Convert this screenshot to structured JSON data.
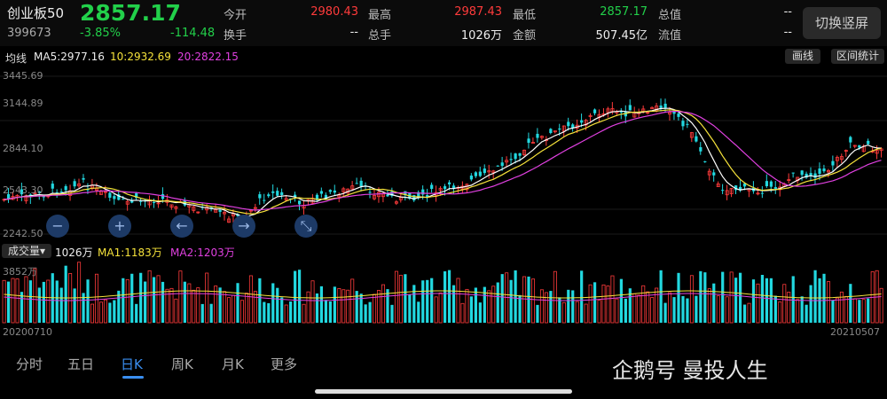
{
  "header": {
    "name": "创业板50",
    "price": "2857.17",
    "code": "399673",
    "change_pct": "-3.85%",
    "change_abs": "-114.48",
    "labels": {
      "open": "今开",
      "high": "最高",
      "low": "最低",
      "total_value": "总值",
      "turnover": "换手",
      "volume": "总手",
      "amount": "金额",
      "float_value": "流值"
    },
    "values": {
      "open": "2980.43",
      "high": "2987.43",
      "low": "2857.17",
      "total_value": "--",
      "turnover": "--",
      "volume": "1026万",
      "amount": "507.45亿",
      "float_value": "--"
    },
    "switch_button": "切换竖屏"
  },
  "ma_bar": {
    "label": "均线",
    "ma5": "MA5:2977.16",
    "ma10": "10:2932.69",
    "ma20": "20:2822.15",
    "draw_button": "画线",
    "stats_button": "区间统计"
  },
  "price_axis": {
    "p1": "3445.69",
    "p2": "3144.89",
    "p3": "2844.10",
    "p4": "2543.30",
    "p5": "2242.50"
  },
  "volume_bar": {
    "selector": "成交量",
    "vol": "1026万",
    "ma1": "MA1:1183万",
    "ma2": "MA2:1203万",
    "max": "3852万"
  },
  "dates": {
    "start": "20200710",
    "end": "20210507"
  },
  "tabs": [
    "分时",
    "五日",
    "日K",
    "周K",
    "月K",
    "更多"
  ],
  "active_tab": "日K",
  "watermark": "企鹅号 曼投人生",
  "colors": {
    "up": "#ff3b3b",
    "down": "#22d8e0",
    "ma5": "#ffffff",
    "ma10": "#f5e23a",
    "ma20": "#e040e0"
  }
}
